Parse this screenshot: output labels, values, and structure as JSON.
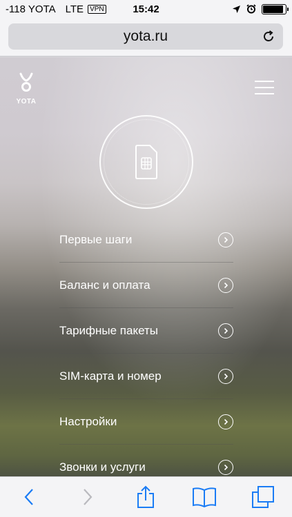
{
  "status": {
    "signal": "-118",
    "carrier": "YOTA",
    "network": "LTE",
    "vpn": "VPN",
    "time": "15:42",
    "battery_level": 0.92
  },
  "browser": {
    "url": "yota.ru"
  },
  "site": {
    "logo_text": "YOTA",
    "menu": [
      {
        "label": "Первые шаги"
      },
      {
        "label": "Баланс и оплата"
      },
      {
        "label": "Тарифные пакеты"
      },
      {
        "label": "SIM-карта и номер"
      },
      {
        "label": "Настройки"
      },
      {
        "label": "Звонки и услуги"
      }
    ]
  },
  "colors": {
    "tint": "#1a7cf5",
    "toolbar_bg": "#f4f4f6",
    "menu_text": "#ffffff"
  },
  "icons": {
    "status": [
      "location-arrow-icon",
      "alarm-icon",
      "battery-icon"
    ],
    "url_bar": [
      "reload-icon"
    ],
    "site": [
      "yota-logo-icon",
      "hamburger-menu-icon",
      "sim-card-icon",
      "chevron-right-circle-icon"
    ],
    "toolbar": [
      "back-icon",
      "forward-icon",
      "share-icon",
      "bookmarks-icon",
      "tabs-icon"
    ]
  }
}
